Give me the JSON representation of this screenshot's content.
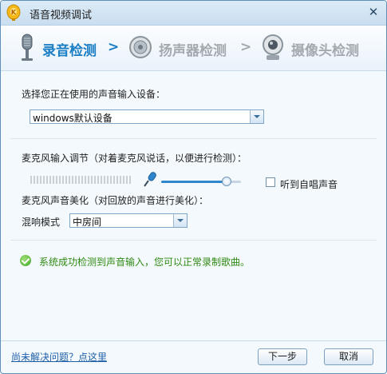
{
  "window": {
    "title": "语音视频调试",
    "close_glyph": "✕"
  },
  "steps": [
    {
      "label": "录音检测",
      "arrow": ">",
      "icon": "microphone-icon",
      "active": true
    },
    {
      "label": "扬声器检测",
      "arrow": ">",
      "icon": "speaker-icon",
      "active": false
    },
    {
      "label": "摄像头检测",
      "arrow": "",
      "icon": "webcam-icon",
      "active": false
    }
  ],
  "input_device": {
    "label": "选择您正在使用的声音输入设备：",
    "selected": "windows默认设备"
  },
  "mic_level": {
    "label": "麦克风输入调节（对着麦克风说话，以便进行检测）：",
    "volume_fraction": 0.82,
    "monitor_checkbox": {
      "label": "听到自唱声音",
      "checked": false
    }
  },
  "mic_beautify": {
    "label": "麦克风声音美化（对回放的声音进行美化）：",
    "reverb_label": "混响模式",
    "reverb_selected": "中房间"
  },
  "status": {
    "icon": "success-check-icon",
    "message": "系统成功检测到声音输入，您可以正常录制歌曲。",
    "color": "#2f8a12"
  },
  "footer": {
    "help_link": "尚未解决问题？点这里",
    "next_label": "下一步",
    "cancel_label": "取消"
  },
  "colors": {
    "accent": "#1a7ec4",
    "inactive_step": "#a3a9ae",
    "link": "#1f5fa8"
  }
}
